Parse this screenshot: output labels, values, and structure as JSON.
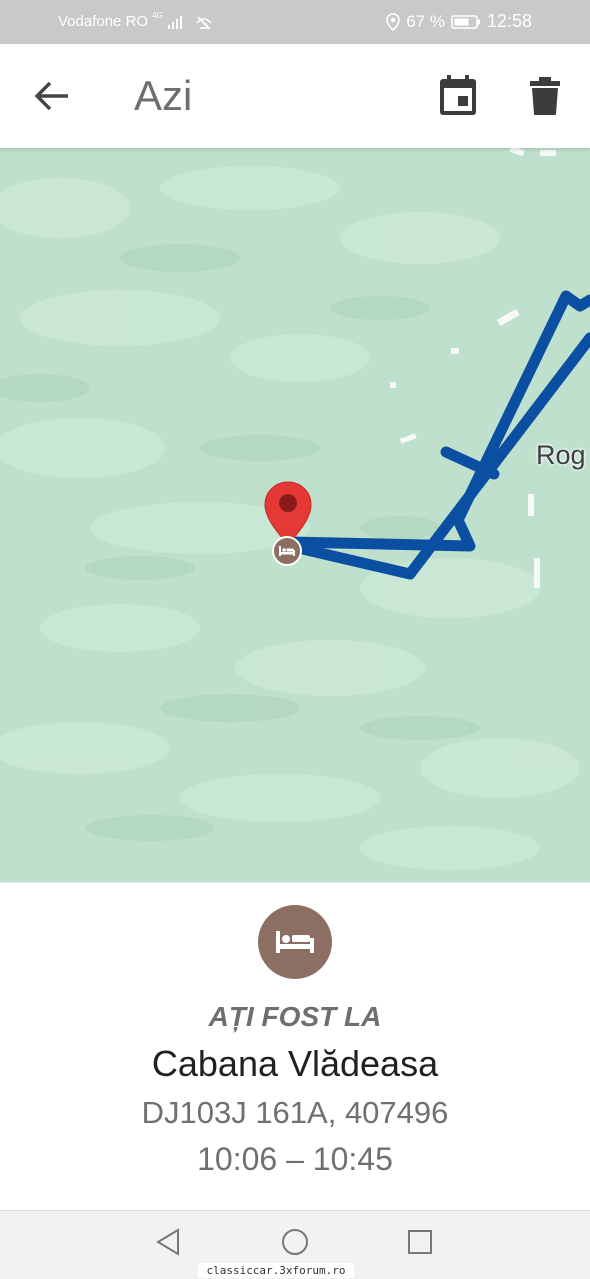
{
  "status_bar": {
    "carrier": "Vodafone RO",
    "network": "4G",
    "battery_percent": "67 %",
    "time": "12:58"
  },
  "app_bar": {
    "title": "Azi",
    "icons": [
      "back-arrow-icon",
      "calendar-icon",
      "trash-icon"
    ]
  },
  "map": {
    "place_label": "Rog",
    "colors": {
      "terrain": "#bfe0cd",
      "route": "#0b4fa3",
      "pin": "#e53935",
      "lodging": "#8d6e63"
    }
  },
  "card": {
    "visited_label": "AȚI FOST LA",
    "place_name": "Cabana Vlădeasa",
    "address": "DJ103J 161A, 407496",
    "time_range": "10:06 – 10:45",
    "icon": "bed-icon"
  },
  "nav_bar": {
    "buttons": [
      "back-triangle-icon",
      "home-circle-icon",
      "recents-square-icon"
    ]
  },
  "watermark": "classiccar.3xforum.ro"
}
